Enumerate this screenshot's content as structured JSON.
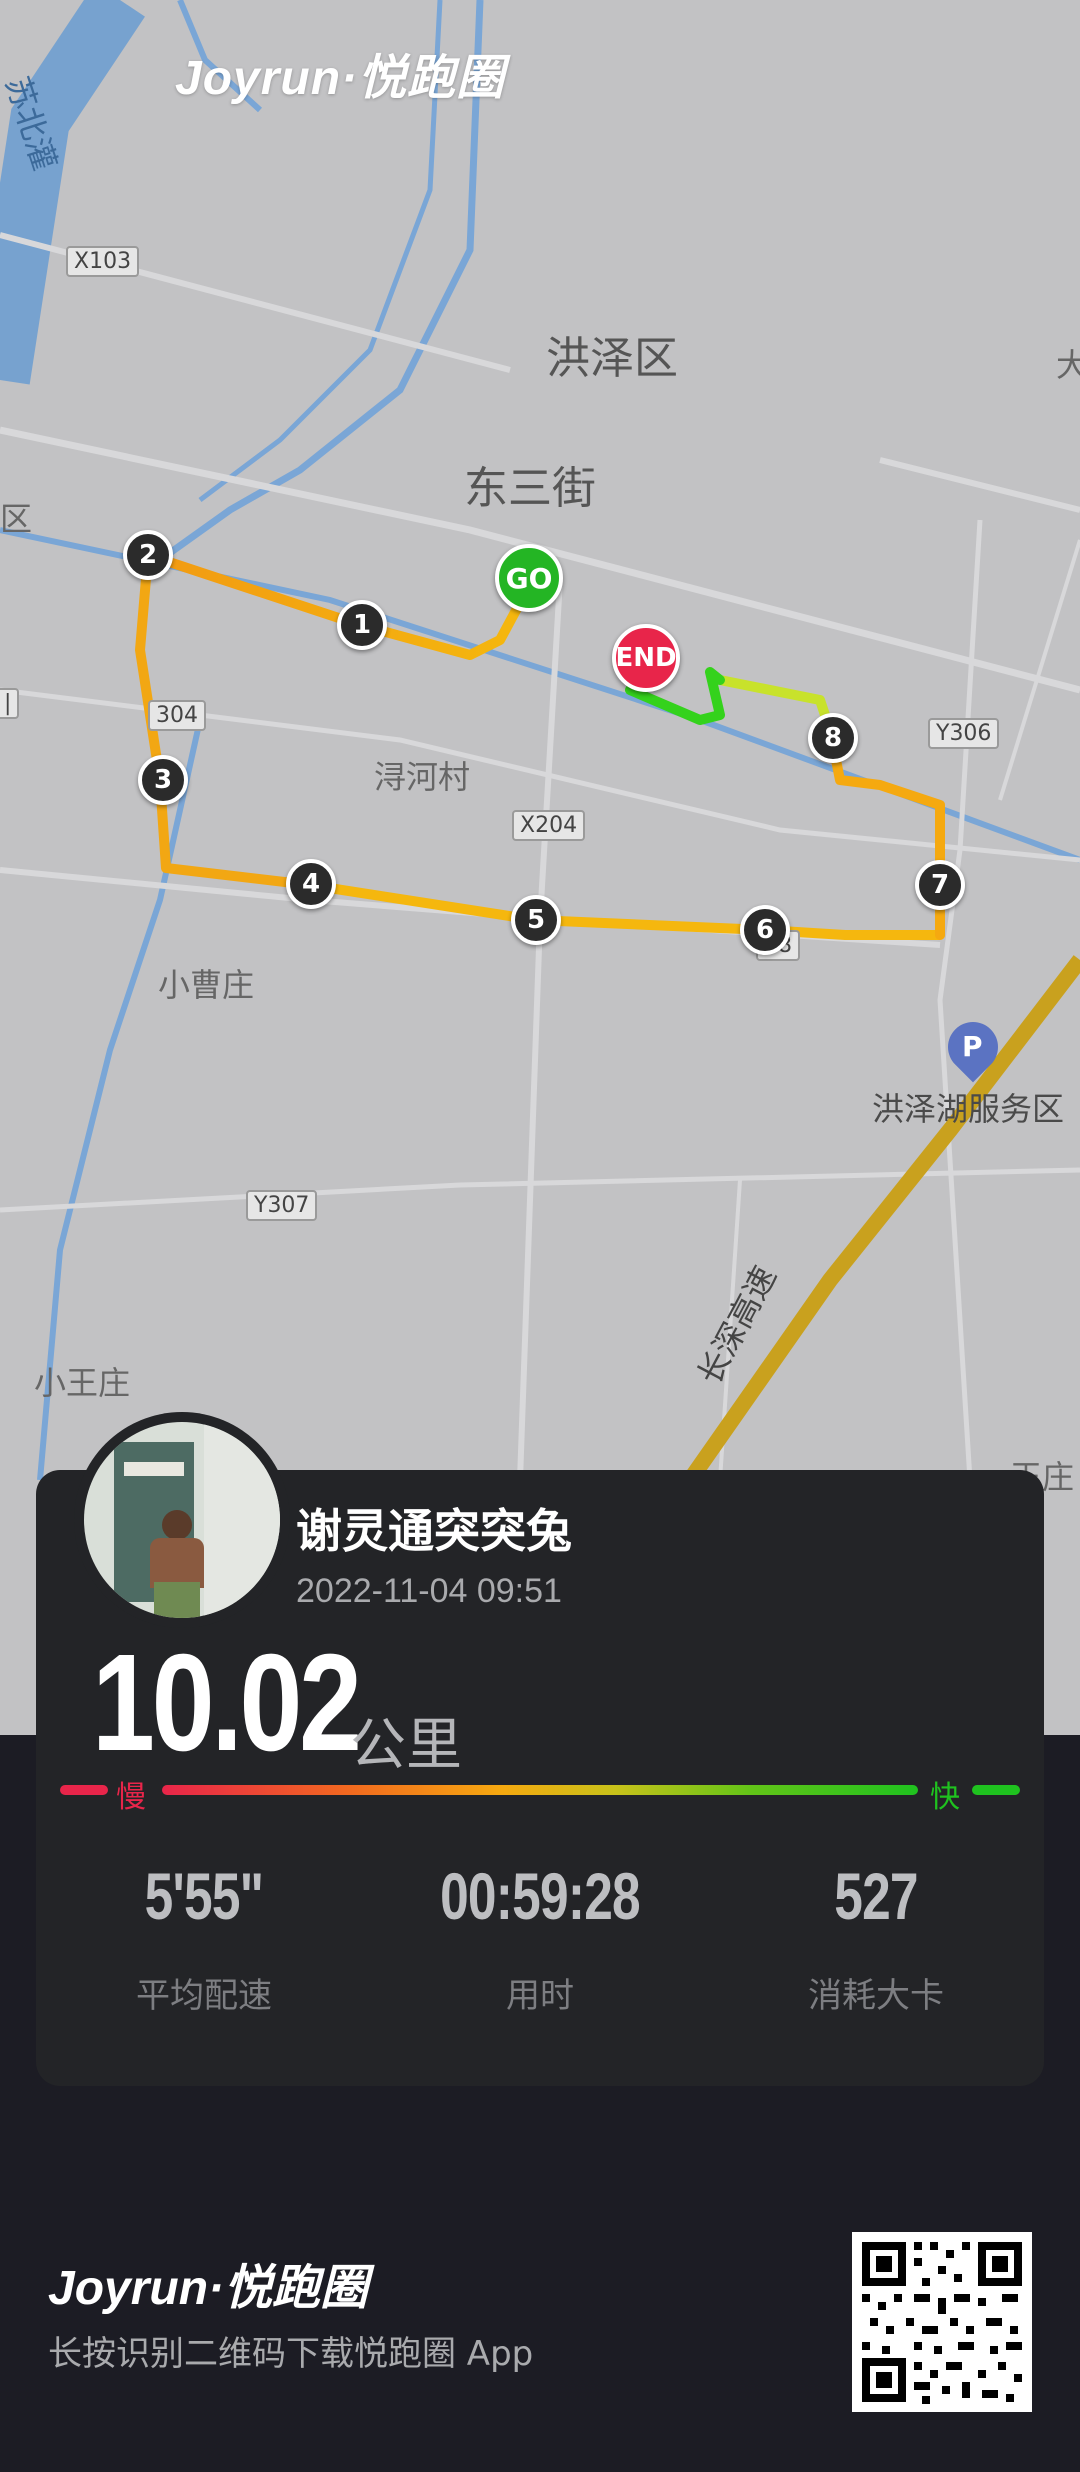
{
  "brand": {
    "name": "Joyrun·悦跑圈"
  },
  "map": {
    "labels": {
      "district": "洪泽区",
      "street": "东三街",
      "village": "浔河村",
      "village2": "小曹庄",
      "village3": "小王庄",
      "service_area": "洪泽湖服务区",
      "highway": "长深高速",
      "canal": "苏北灌",
      "edge_left": "区",
      "edge_right_top": "大",
      "edge_right_bottom": "王庄"
    },
    "roads": {
      "x103": "X103",
      "y304": "304",
      "left_edge_badge": "|",
      "x204": "X204",
      "y306": "Y306",
      "y307": "Y307",
      "road_248": "48"
    },
    "markers": {
      "start": "GO",
      "end": "END",
      "km": [
        "1",
        "2",
        "3",
        "4",
        "5",
        "6",
        "7",
        "8"
      ]
    },
    "parking_icon": "P"
  },
  "run": {
    "user_name": "谢灵通突突兔",
    "datetime": "2022-11-04 09:51",
    "distance": "10.02",
    "distance_unit": "公里",
    "pace_slow": "慢",
    "pace_fast": "快",
    "stats": [
      {
        "value": "5'55\"",
        "label": "平均配速"
      },
      {
        "value": "00:59:28",
        "label": "用时"
      },
      {
        "value": "527",
        "label": "消耗大卡"
      }
    ]
  },
  "footer": {
    "brand": "Joyrun·悦跑圈",
    "tagline": "长按识别二维码下载悦跑圈 App"
  },
  "colors": {
    "slow": "#e8254a",
    "fast": "#1fc21f",
    "card": "#232427",
    "page_bg": "#1c1c24",
    "map_bg": "#c2c2c4"
  }
}
